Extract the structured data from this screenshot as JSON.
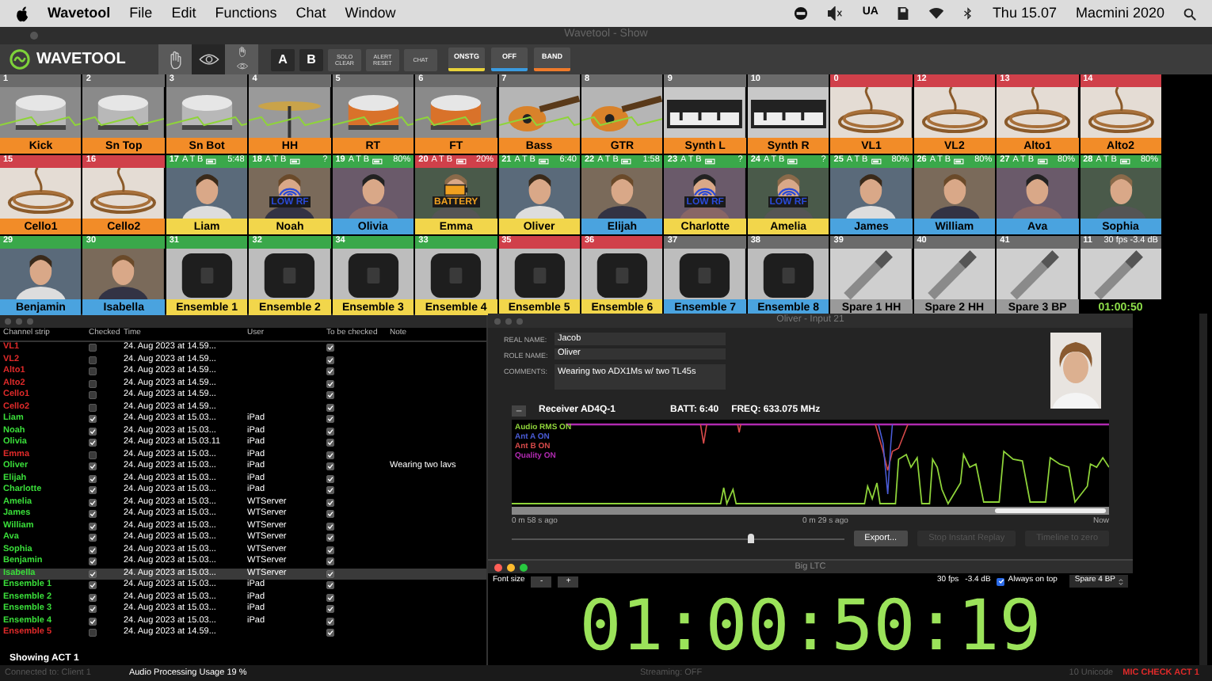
{
  "menubar": {
    "app": "Wavetool",
    "menus": [
      "File",
      "Edit",
      "Functions",
      "Chat",
      "Window"
    ],
    "input_source": "UA",
    "clock": "Thu 15.07",
    "computer": "Macmini 2020"
  },
  "window": {
    "title": "Wavetool - Show"
  },
  "toolbar": {
    "logo": "WAVETOOL",
    "view_buttons": [
      {
        "kind": "hand",
        "selected": false
      },
      {
        "kind": "eye",
        "selected": true
      },
      {
        "kind": "hand_eye",
        "selected": false
      }
    ],
    "letter_buttons": [
      "A",
      "B"
    ],
    "action_buttons": [
      "SOLO CLEAR",
      "ALERT RESET",
      "CHAT"
    ],
    "filters": [
      {
        "label": "ONSTG",
        "color": "#e8d23a"
      },
      {
        "label": "OFF",
        "color": "#3a9be0"
      },
      {
        "label": "BAND",
        "color": "#f07a2a"
      }
    ]
  },
  "grid": {
    "rows": [
      [
        {
          "number": "1",
          "header": {
            "color": "#6b6b6b"
          },
          "label": "Kick",
          "color": "#f28c28"
        },
        {
          "number": "2",
          "header": {
            "color": "#6b6b6b"
          },
          "label": "Sn Top",
          "color": "#f28c28"
        },
        {
          "number": "3",
          "header": {
            "color": "#6b6b6b"
          },
          "label": "Sn Bot",
          "color": "#f28c28"
        },
        {
          "number": "4",
          "header": {
            "color": "#6b6b6b"
          },
          "label": "HH",
          "color": "#f28c28"
        },
        {
          "number": "5",
          "header": {
            "color": "#6b6b6b"
          },
          "label": "RT",
          "color": "#f28c28"
        },
        {
          "number": "6",
          "header": {
            "color": "#6b6b6b"
          },
          "label": "FT",
          "color": "#f28c28"
        },
        {
          "number": "7",
          "header": {
            "color": "#6b6b6b"
          },
          "label": "Bass",
          "color": "#f28c28"
        },
        {
          "number": "8",
          "header": {
            "color": "#6b6b6b"
          },
          "label": "GTR",
          "color": "#f28c28"
        },
        {
          "number": "9",
          "header": {
            "color": "#6b6b6b"
          },
          "label": "Synth L",
          "color": "#f28c28"
        },
        {
          "number": "10",
          "header": {
            "color": "#6b6b6b"
          },
          "label": "Synth R",
          "color": "#f28c28"
        },
        {
          "number": "0",
          "header": {
            "color": "#d0404a"
          },
          "label": "VL1",
          "color": "#f28c28"
        },
        {
          "number": "12",
          "header": {
            "color": "#d0404a"
          },
          "label": "VL2",
          "color": "#f28c28"
        },
        {
          "number": "13",
          "header": {
            "color": "#d0404a"
          },
          "label": "Alto1",
          "color": "#f28c28"
        },
        {
          "number": "14",
          "header": {
            "color": "#d0404a"
          },
          "label": "Alto2",
          "color": "#f28c28"
        }
      ],
      [
        {
          "number": "15",
          "header": {
            "color": "#d0404a"
          },
          "label": "Cello1",
          "color": "#f28c28"
        },
        {
          "number": "16",
          "header": {
            "color": "#d0404a"
          },
          "label": "Cello2",
          "color": "#f28c28"
        },
        {
          "number": "17",
          "header": {
            "color": "#3aa84a"
          },
          "flags": "A T B",
          "status": "5:48",
          "label": "Liam",
          "color": "#f2d64b"
        },
        {
          "number": "18",
          "header": {
            "color": "#3aa84a"
          },
          "flags": "A T B",
          "status": "?",
          "alert": {
            "kind": "rf",
            "text": "LOW RF"
          },
          "label": "Noah",
          "color": "#f2d64b"
        },
        {
          "number": "19",
          "header": {
            "color": "#3aa84a"
          },
          "flags": "A T B",
          "status": "80%",
          "label": "Olivia",
          "color": "#4aa3df"
        },
        {
          "number": "20",
          "header": {
            "color": "#d0404a"
          },
          "flags": "A T B",
          "status": "20%",
          "alert": {
            "kind": "battery",
            "text": "BATTERY"
          },
          "label": "Emma",
          "color": "#f2d64b"
        },
        {
          "number": "21",
          "header": {
            "color": "#3aa84a"
          },
          "flags": "A T B",
          "status": "6:40",
          "label": "Oliver",
          "color": "#f2d64b"
        },
        {
          "number": "22",
          "header": {
            "color": "#3aa84a"
          },
          "flags": "A T B",
          "status": "1:58",
          "label": "Elijah",
          "color": "#4aa3df"
        },
        {
          "number": "23",
          "header": {
            "color": "#3aa84a"
          },
          "flags": "A T B",
          "status": "?",
          "alert": {
            "kind": "rf",
            "text": "LOW RF"
          },
          "label": "Charlotte",
          "color": "#f2d64b"
        },
        {
          "number": "24",
          "header": {
            "color": "#3aa84a"
          },
          "flags": "A T B",
          "status": "?",
          "alert": {
            "kind": "rf",
            "text": "LOW RF"
          },
          "label": "Amelia",
          "color": "#f2d64b"
        },
        {
          "number": "25",
          "header": {
            "color": "#3aa84a"
          },
          "flags": "A T B",
          "status": "80%",
          "label": "James",
          "color": "#4aa3df"
        },
        {
          "number": "26",
          "header": {
            "color": "#3aa84a"
          },
          "flags": "A T B",
          "status": "80%",
          "label": "William",
          "color": "#4aa3df"
        },
        {
          "number": "27",
          "header": {
            "color": "#3aa84a"
          },
          "flags": "A T B",
          "status": "80%",
          "label": "Ava",
          "color": "#4aa3df"
        },
        {
          "number": "28",
          "header": {
            "color": "#3aa84a"
          },
          "flags": "A T B",
          "status": "80%",
          "label": "Sophia",
          "color": "#4aa3df"
        }
      ],
      [
        {
          "number": "29",
          "header": {
            "color": "#3aa84a"
          },
          "label": "Benjamin",
          "color": "#4aa3df"
        },
        {
          "number": "30",
          "header": {
            "color": "#3aa84a"
          },
          "label": "Isabella",
          "color": "#4aa3df"
        },
        {
          "number": "31",
          "header": {
            "color": "#3aa84a"
          },
          "label": "Ensemble 1",
          "color": "#f2d64b"
        },
        {
          "number": "32",
          "header": {
            "color": "#3aa84a"
          },
          "label": "Ensemble 2",
          "color": "#f2d64b"
        },
        {
          "number": "34",
          "header": {
            "color": "#3aa84a"
          },
          "label": "Ensemble 3",
          "color": "#f2d64b"
        },
        {
          "number": "33",
          "header": {
            "color": "#3aa84a"
          },
          "label": "Ensemble 4",
          "color": "#f2d64b"
        },
        {
          "number": "35",
          "header": {
            "color": "#d0404a"
          },
          "label": "Ensemble 5",
          "color": "#f2d64b"
        },
        {
          "number": "36",
          "header": {
            "color": "#d0404a"
          },
          "label": "Ensemble 6",
          "color": "#f2d64b"
        },
        {
          "number": "37",
          "header": {
            "color": "#6b6b6b"
          },
          "label": "Ensemble 7",
          "color": "#4aa3df"
        },
        {
          "number": "38",
          "header": {
            "color": "#6b6b6b"
          },
          "label": "Ensemble 8",
          "color": "#4aa3df"
        },
        {
          "number": "39",
          "header": {
            "color": "#6b6b6b"
          },
          "label": "Spare 1 HH",
          "color": "#9a9a9a"
        },
        {
          "number": "40",
          "header": {
            "color": "#6b6b6b"
          },
          "label": "Spare 2 HH",
          "color": "#9a9a9a"
        },
        {
          "number": "41",
          "header": {
            "color": "#6b6b6b"
          },
          "label": "Spare 3 BP",
          "color": "#9a9a9a"
        },
        {
          "number": "11",
          "header": {
            "color": "#6b6b6b"
          },
          "status": "30 fps  -3.4 dB",
          "label": "01:00:50",
          "color": "#000000"
        }
      ]
    ]
  },
  "checklist": {
    "columns": [
      "Channel strip",
      "Checked",
      "Time",
      "User",
      "To be checked",
      "Note"
    ],
    "rows": [
      {
        "name": "VL1",
        "checked": false,
        "time": "24. Aug 2023 at 14.59...",
        "user": "",
        "to_be_checked": true,
        "note": "",
        "selected": false
      },
      {
        "name": "VL2",
        "checked": false,
        "time": "24. Aug 2023 at 14.59...",
        "user": "",
        "to_be_checked": true,
        "note": "",
        "selected": false
      },
      {
        "name": "Alto1",
        "checked": false,
        "time": "24. Aug 2023 at 14.59...",
        "user": "",
        "to_be_checked": true,
        "note": "",
        "selected": false
      },
      {
        "name": "Alto2",
        "checked": false,
        "time": "24. Aug 2023 at 14.59...",
        "user": "",
        "to_be_checked": true,
        "note": "",
        "selected": false
      },
      {
        "name": "Cello1",
        "checked": false,
        "time": "24. Aug 2023 at 14.59...",
        "user": "",
        "to_be_checked": true,
        "note": "",
        "selected": false
      },
      {
        "name": "Cello2",
        "checked": false,
        "time": "24. Aug 2023 at 14.59...",
        "user": "",
        "to_be_checked": true,
        "note": "",
        "selected": false
      },
      {
        "name": "Liam",
        "checked": true,
        "time": "24. Aug 2023 at 15.03...",
        "user": "iPad",
        "to_be_checked": true,
        "note": "",
        "selected": false
      },
      {
        "name": "Noah",
        "checked": true,
        "time": "24. Aug 2023 at 15.03...",
        "user": "iPad",
        "to_be_checked": true,
        "note": "",
        "selected": false
      },
      {
        "name": "Olivia",
        "checked": true,
        "time": "24. Aug 2023 at 15.03.11",
        "user": "iPad",
        "to_be_checked": true,
        "note": "",
        "selected": false
      },
      {
        "name": "Emma",
        "checked": false,
        "time": "24. Aug 2023 at 15.03...",
        "user": "iPad",
        "to_be_checked": true,
        "note": "",
        "selected": false
      },
      {
        "name": "Oliver",
        "checked": true,
        "time": "24. Aug 2023 at 15.03...",
        "user": "iPad",
        "to_be_checked": true,
        "note": "Wearing two lavs",
        "selected": false
      },
      {
        "name": "Elijah",
        "checked": true,
        "time": "24. Aug 2023 at 15.03...",
        "user": "iPad",
        "to_be_checked": true,
        "note": "",
        "selected": false
      },
      {
        "name": "Charlotte",
        "checked": true,
        "time": "24. Aug 2023 at 15.03...",
        "user": "iPad",
        "to_be_checked": true,
        "note": "",
        "selected": false
      },
      {
        "name": "Amelia",
        "checked": true,
        "time": "24. Aug 2023 at 15.03...",
        "user": "WTServer",
        "to_be_checked": true,
        "note": "",
        "selected": false
      },
      {
        "name": "James",
        "checked": true,
        "time": "24. Aug 2023 at 15.03...",
        "user": "WTServer",
        "to_be_checked": true,
        "note": "",
        "selected": false
      },
      {
        "name": "William",
        "checked": true,
        "time": "24. Aug 2023 at 15.03...",
        "user": "WTServer",
        "to_be_checked": true,
        "note": "",
        "selected": false
      },
      {
        "name": "Ava",
        "checked": true,
        "time": "24. Aug 2023 at 15.03...",
        "user": "WTServer",
        "to_be_checked": true,
        "note": "",
        "selected": false
      },
      {
        "name": "Sophia",
        "checked": true,
        "time": "24. Aug 2023 at 15.03...",
        "user": "WTServer",
        "to_be_checked": true,
        "note": "",
        "selected": false
      },
      {
        "name": "Benjamin",
        "checked": true,
        "time": "24. Aug 2023 at 15.03...",
        "user": "WTServer",
        "to_be_checked": true,
        "note": "",
        "selected": false
      },
      {
        "name": "Isabella",
        "checked": true,
        "time": "24. Aug 2023 at 15.03...",
        "user": "WTServer",
        "to_be_checked": true,
        "note": "",
        "selected": true
      },
      {
        "name": "Ensemble 1",
        "checked": true,
        "time": "24. Aug 2023 at 15.03...",
        "user": "iPad",
        "to_be_checked": true,
        "note": "",
        "selected": false
      },
      {
        "name": "Ensemble 2",
        "checked": true,
        "time": "24. Aug 2023 at 15.03...",
        "user": "iPad",
        "to_be_checked": true,
        "note": "",
        "selected": false
      },
      {
        "name": "Ensemble 3",
        "checked": true,
        "time": "24. Aug 2023 at 15.03...",
        "user": "iPad",
        "to_be_checked": true,
        "note": "",
        "selected": false
      },
      {
        "name": "Ensemble 4",
        "checked": true,
        "time": "24. Aug 2023 at 15.03...",
        "user": "iPad",
        "to_be_checked": true,
        "note": "",
        "selected": false
      },
      {
        "name": "Ensemble 5",
        "checked": false,
        "time": "24. Aug 2023 at 14.59...",
        "user": "",
        "to_be_checked": true,
        "note": "",
        "selected": false
      }
    ],
    "footer": "Showing ACT 1"
  },
  "detail": {
    "title": "Oliver - Input 21",
    "fields": [
      {
        "label": "REAL NAME:",
        "value": "Jacob"
      },
      {
        "label": "ROLE NAME:",
        "value": "Oliver"
      },
      {
        "label": "COMMENTS:",
        "value": "Wearing two ADX1Ms w/ two TL45s"
      }
    ],
    "collapse_button": "–",
    "receiver": "Receiver AD4Q-1",
    "battery": "BATT: 6:40",
    "frequency": "FREQ: 633.075 MHz",
    "legend": [
      {
        "label": "Audio RMS ON",
        "color": "#8fd43a"
      },
      {
        "label": "Ant A ON",
        "color": "#4a5cd8"
      },
      {
        "label": "Ant B ON",
        "color": "#d84a4a"
      },
      {
        "label": "Quality ON",
        "color": "#b02ab0"
      }
    ],
    "time_labels": [
      "0 m 58 s ago",
      "0 m 29 s ago",
      "Now"
    ],
    "scrub": {
      "level": 0.72
    },
    "buttons": [
      {
        "label": "Export...",
        "disabled": false
      },
      {
        "label": "Stop Instant Replay",
        "disabled": true
      },
      {
        "label": "Timeline to zero",
        "disabled": true
      }
    ]
  },
  "ltc": {
    "title": "Big LTC",
    "font_size_label": "Font size",
    "size_buttons": [
      "-",
      "+"
    ],
    "fps": "30 fps",
    "level_reading": "-3.4 dB",
    "always_on_top": {
      "label": "Always on top",
      "checked": true
    },
    "source": "Spare 4 BP",
    "timecode": "01:00:50:19"
  },
  "status_bar": {
    "connection": "Connected to: Client 1",
    "usage": "Audio Processing Usage 19 %",
    "streaming": "Streaming: OFF",
    "unicode": "10 Unicode",
    "alert": "MIC CHECK ACT 1"
  }
}
